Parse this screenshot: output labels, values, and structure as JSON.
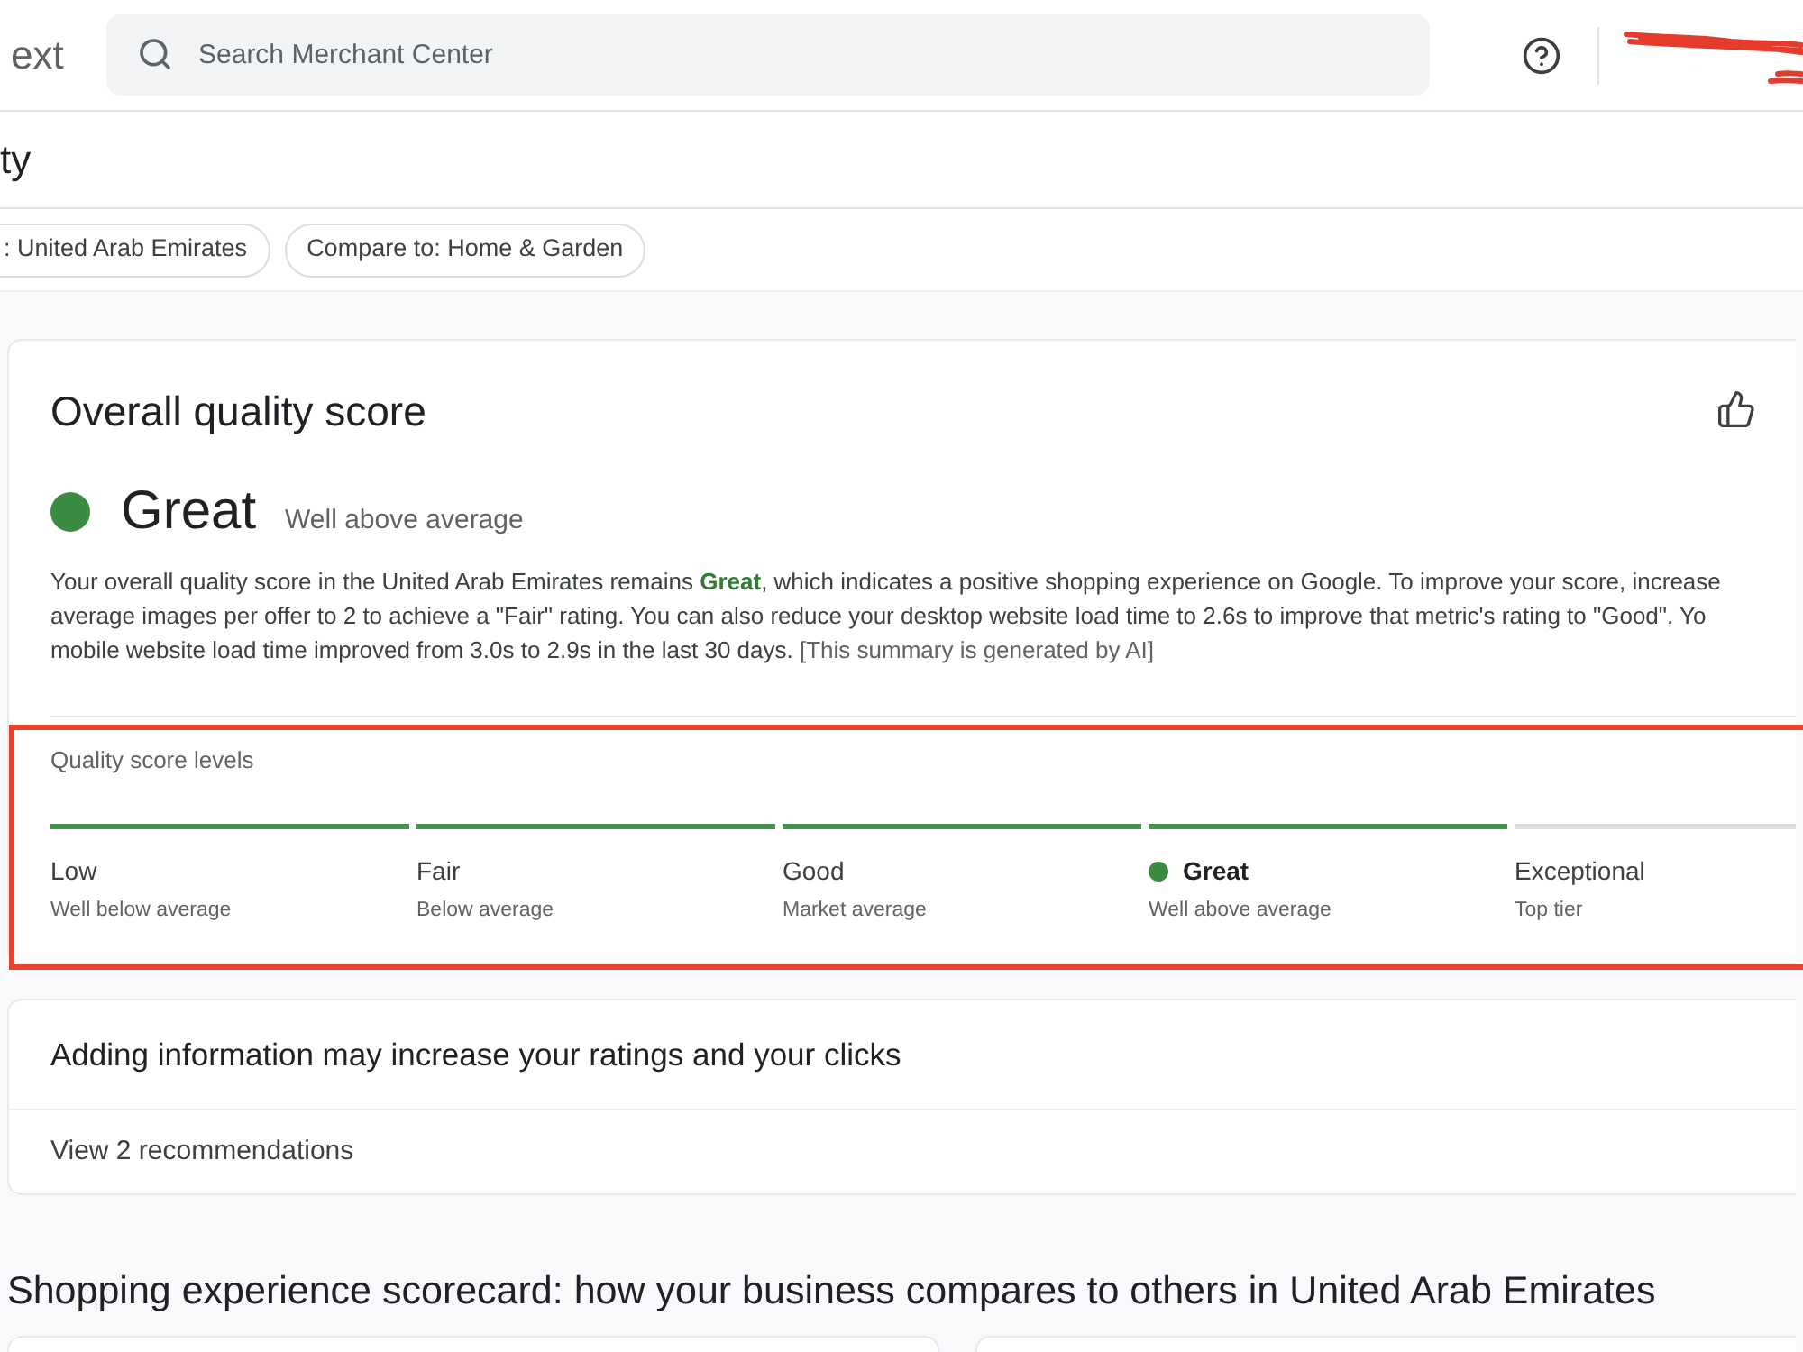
{
  "top_bar": {
    "product_name": "ext",
    "search": {
      "placeholder": "Search Merchant Center"
    },
    "account": {
      "redacted": true
    }
  },
  "page_title": "ty",
  "filters": [
    {
      "label": ": United Arab Emirates"
    },
    {
      "label": "Compare to: Home & Garden"
    }
  ],
  "overall": {
    "title": "Overall quality score",
    "rating": "Great",
    "rating_caption": "Well above average",
    "summary_lines": [
      "Your overall quality score in the United Arab Emirates remains **Great**, which indicates a positive shopping experience on Google. To improve your score, increase",
      "average images per offer to 2 to achieve a \"Fair\" rating. You can also reduce your desktop website load time to 2.6s to improve that metric's rating to \"Good\". Yo",
      "mobile website load time improved from 3.0s to 2.9s in the last 30 days."
    ],
    "ai_note": "[This summary is generated by AI]"
  },
  "levels": {
    "title": "Quality score levels",
    "highlighted": true,
    "items": [
      {
        "label": "Low",
        "caption": "Well below average",
        "reached": true,
        "selected": false
      },
      {
        "label": "Fair",
        "caption": "Below average",
        "reached": true,
        "selected": false
      },
      {
        "label": "Good",
        "caption": "Market average",
        "reached": true,
        "selected": false
      },
      {
        "label": "Great",
        "caption": "Well above average",
        "reached": true,
        "selected": true
      },
      {
        "label": "Exceptional",
        "caption": "Top tier",
        "reached": false,
        "selected": false
      }
    ]
  },
  "recommendations": {
    "heading": "Adding information may increase your ratings and your clicks",
    "link": "View 2 recommendations"
  },
  "scorecard": {
    "title": "Shopping experience scorecard: how your business compares to others in United Arab Emirates"
  }
}
